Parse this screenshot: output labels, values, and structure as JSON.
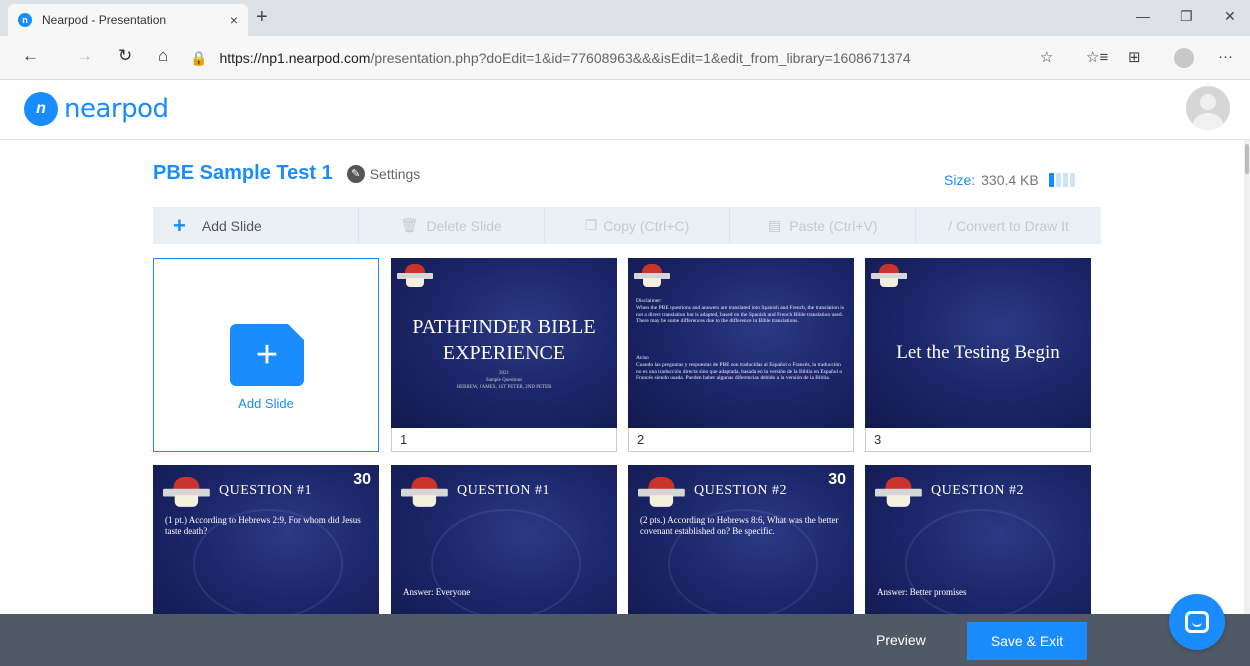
{
  "browser": {
    "tab_title": "Nearpod - Presentation",
    "tab_close": "×",
    "new_tab": "+",
    "url_host": "https://np1.nearpod.com",
    "url_path": "/presentation.php?doEdit=1&id=77608963&&&isEdit=1&edit_from_library=1608671374",
    "window": {
      "minimize": "—",
      "restore": "❐",
      "close": "✕"
    },
    "nav": {
      "back": "←",
      "forward": "→",
      "refresh": "↻",
      "home": "⌂"
    },
    "toolbar": {
      "favorite": "☆",
      "favorites": "☆≡",
      "collections": "⊞",
      "more": "···"
    }
  },
  "app": {
    "logo_mark": "n",
    "logo_text": "nearpod",
    "brand_color": "#1a8cff"
  },
  "presentation": {
    "title": "PBE Sample Test 1",
    "settings_label": "Settings",
    "size_label": "Size:",
    "size_value": "330.4 KB"
  },
  "actions": {
    "add": "Add Slide",
    "delete": "Delete Slide",
    "copy": "Copy (Ctrl+C)",
    "paste": "Paste (Ctrl+V)",
    "convert": "Convert to Draw It"
  },
  "add_card": {
    "label": "Add Slide"
  },
  "slides": [
    {
      "number": "1",
      "title_line1": "PATHFINDER BIBLE",
      "title_line2": "EXPERIENCE",
      "sub1": "2021",
      "sub2": "Sample Questions",
      "sub3": "HEBREW, JAMES, 1ST PETER, 2ND PETER"
    },
    {
      "number": "2",
      "disclaimer_head": "Disclaimer:",
      "disclaimer_body": "When the PBE questions and answers are translated into Spanish and French, the translation is not a direct translation but is adapted, based on the Spanish and French Bible translation used. There may be some differences due to the difference in Bible translations.",
      "aviso_head": "Aviso",
      "aviso_body": "Cuando las preguntas y respuestas de PBE son traducidas al Español o Francés, la traducción no es una traducción directa sino que adaptada, basada en la versión de la Biblia en Español o Francés siendo usada. Pueden haber algunas diferencias debido a la versión de la Biblia."
    },
    {
      "number": "3",
      "title": "Let the Testing Begin"
    },
    {
      "heading": "QUESTION #1",
      "points": "30",
      "text": "(1 pt.) According to Hebrews 2:9, For whom did Jesus taste death?"
    },
    {
      "heading": "QUESTION #1",
      "answer": "Answer:   Everyone"
    },
    {
      "heading": "QUESTION #2",
      "points": "30",
      "text": "(2 pts.) According to Hebrews 8:6, What was the better covenant established on?  Be specific."
    },
    {
      "heading": "QUESTION #2",
      "answer": "Answer:   Better promises"
    }
  ],
  "footer": {
    "preview": "Preview",
    "save_exit": "Save & Exit"
  }
}
